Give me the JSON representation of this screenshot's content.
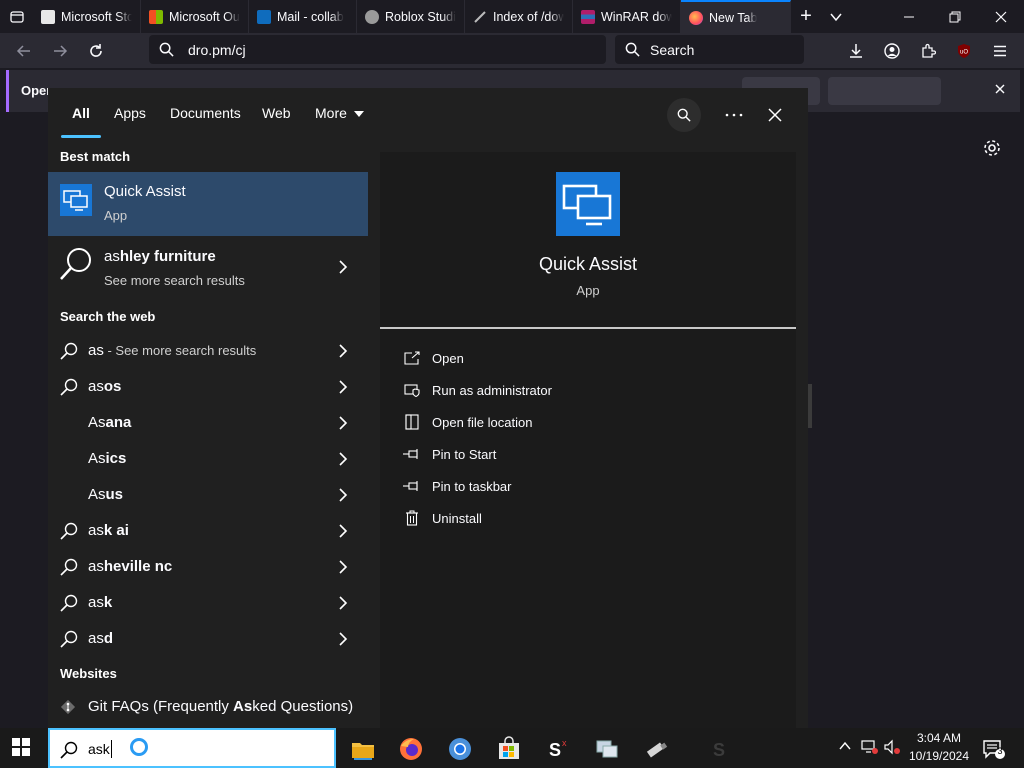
{
  "browser": {
    "tabs": [
      {
        "label": "Microsoft Sto"
      },
      {
        "label": "Microsoft Ou"
      },
      {
        "label": "Mail - collab"
      },
      {
        "label": "Roblox Studio"
      },
      {
        "label": "Index of /dow"
      },
      {
        "label": "WinRAR dow"
      },
      {
        "label": "New Tab",
        "active": true
      }
    ],
    "url": "dro.pm/cj",
    "search_placeholder": "Search",
    "notification_text": "Oper"
  },
  "start_search": {
    "tabs": [
      "All",
      "Apps",
      "Documents",
      "Web",
      "More"
    ],
    "best_match_heading": "Best match",
    "best_match": {
      "title": "Quick Assist",
      "subtitle": "App"
    },
    "second_result": {
      "title_plain": "as",
      "title_bold": "hley furniture",
      "subtitle": "See more search results"
    },
    "search_web_heading": "Search the web",
    "web_results": [
      {
        "plain": "as",
        "bold": "",
        "sub": " - See more search results",
        "icon": true
      },
      {
        "plain": "as",
        "bold": "os",
        "sub": "",
        "icon": true
      },
      {
        "plain": "As",
        "bold": "ana",
        "sub": "",
        "icon": false
      },
      {
        "plain": "As",
        "bold": "ics",
        "sub": "",
        "icon": false
      },
      {
        "plain": "As",
        "bold": "us",
        "sub": "",
        "icon": false
      },
      {
        "plain": "as",
        "bold": "k ai",
        "sub": "",
        "icon": true
      },
      {
        "plain": "as",
        "bold": "heville nc",
        "sub": "",
        "icon": true
      },
      {
        "plain": "as",
        "bold": "k",
        "sub": "",
        "icon": true
      },
      {
        "plain": "as",
        "bold": "d",
        "sub": "",
        "icon": true
      }
    ],
    "websites_heading": "Websites",
    "website": {
      "pre": "Git FAQs (Frequently ",
      "bold": "As",
      "post": "ked Questions)"
    },
    "preview": {
      "app_name": "Quick Assist",
      "app_type": "App",
      "actions": [
        {
          "label": "Open",
          "icon": "open-icon"
        },
        {
          "label": "Run as administrator",
          "icon": "shield-icon"
        },
        {
          "label": "Open file location",
          "icon": "folder-icon"
        },
        {
          "label": "Pin to Start",
          "icon": "pin-icon"
        },
        {
          "label": "Pin to taskbar",
          "icon": "pin-icon"
        },
        {
          "label": "Uninstall",
          "icon": "trash-icon"
        }
      ]
    }
  },
  "taskbar": {
    "search_text": "ask",
    "time": "3:04 AM",
    "date": "10/19/2024",
    "notification_count": "3"
  }
}
